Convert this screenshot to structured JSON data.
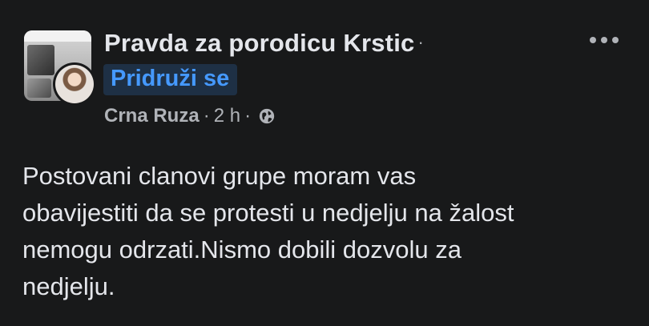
{
  "post": {
    "group_name": "Pravda za porodicu Krstic",
    "title_separator": "·",
    "join_label": "Pridruži se",
    "author": "Crna Ruza",
    "time": "2 h",
    "meta_separator": "·",
    "privacy_icon": "globe-icon",
    "more_icon": "more-options-icon",
    "body_lines": [
      "Postovani clanovi grupe moram vas",
      "obavijestiti da se protesti u nedjelju na žalost",
      "nemogu odrzati.Nismo dobili dozvolu za",
      "nedjelju."
    ]
  },
  "colors": {
    "background": "#18191a",
    "primary_text": "#e4e6eb",
    "secondary_text": "#b0b3b8",
    "join_button_bg": "#1e3045",
    "join_button_text": "#4599ff"
  }
}
